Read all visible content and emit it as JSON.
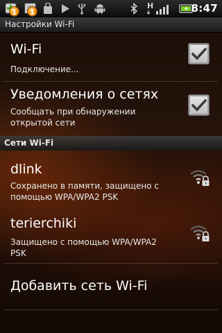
{
  "status_bar": {
    "time": "8:47",
    "notification_badges": [
      "1",
      "1"
    ],
    "icons": [
      "add-icon",
      "image-icon",
      "bag-icon",
      "play-icon",
      "usb-icon",
      "android-debug-icon",
      "bluetooth-icon",
      "hspa-signal-icon",
      "battery-icon"
    ],
    "hspa_label": "H"
  },
  "title_bar": {
    "title": "Настройки Wi-Fi"
  },
  "wifi_toggle": {
    "title": "Wi-Fi",
    "subtitle": "Подключение...",
    "checked": true
  },
  "network_notifications": {
    "title": "Уведомления о сетях",
    "subtitle_line1": "Сообщать при обнаружении",
    "subtitle_line2": "открытой сети",
    "checked": true
  },
  "networks_header": {
    "label": "Сети Wi-Fi"
  },
  "networks": [
    {
      "ssid": "dlink",
      "status_line1": "Сохранено в памяти, защищено с",
      "status_line2": "помощью WPA/WPA2 PSK",
      "icon": "wifi-locked-icon"
    },
    {
      "ssid": "terierchiki",
      "status_line1": "Защищено с помощью WPA/WPA2",
      "status_line2": "PSK",
      "icon": "wifi-locked-icon"
    }
  ],
  "add_network": {
    "label": "Добавить сеть Wi-Fi"
  },
  "colors": {
    "status_bar": "#0c0c0c",
    "title_bar": "#2a2a2a",
    "background_accent": "#963710",
    "text": "#ffffff",
    "badge": "#f08a00",
    "battery": "#7cd32b"
  }
}
